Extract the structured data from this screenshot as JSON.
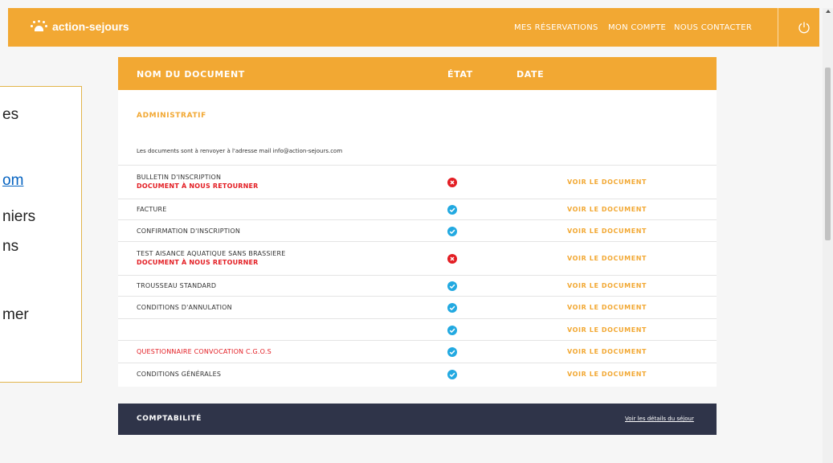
{
  "header": {
    "brand": "action-sejours",
    "nav": [
      "MES RÉSERVATIONS",
      "MON COMPTE",
      "NOUS CONTACTER"
    ],
    "logout_icon": "power-icon",
    "background": "#f2a833"
  },
  "callout": {
    "lines": [
      "es",
      "om",
      "niers",
      "ns",
      "mer"
    ]
  },
  "table": {
    "columns": [
      "NOM DU DOCUMENT",
      "ÉTAT",
      "DATE"
    ],
    "section": "ADMINISTRATIF",
    "note": "Les documents sont à renvoyer à l'adresse mail info@action-sejours.com",
    "view_label": "VOIR LE DOCUMENT",
    "rows": [
      {
        "name": "BULLETIN D'INSCRIPTION",
        "sub": "DOCUMENT À NOUS RETOURNER",
        "status": "missing"
      },
      {
        "name": "FACTURE",
        "sub": "",
        "status": "ok"
      },
      {
        "name": "CONFIRMATION D'INSCRIPTION",
        "sub": "",
        "status": "ok"
      },
      {
        "name": "TEST AISANCE AQUATIQUE SANS BRASSIERE",
        "sub": "DOCUMENT À NOUS RETOURNER",
        "status": "missing"
      },
      {
        "name": "TROUSSEAU STANDARD",
        "sub": "",
        "status": "ok"
      },
      {
        "name": "CONDITIONS D'ANNULATION",
        "sub": "",
        "status": "ok"
      },
      {
        "name": "",
        "sub": "",
        "status": "ok"
      },
      {
        "name": "QUESTIONNAIRE CONVOCATION C.G.O.S",
        "sub": "",
        "status": "ok",
        "highlight": true
      },
      {
        "name": "CONDITIONS GÉNÉRALES",
        "sub": "",
        "status": "ok"
      }
    ]
  },
  "compta": {
    "title": "COMPTABILITÉ",
    "link": "Voir les détails du séjour"
  },
  "colors": {
    "accent": "#f2a833",
    "ok": "#22a9e1",
    "missing": "#e31e24",
    "dark": "#2f3449"
  }
}
